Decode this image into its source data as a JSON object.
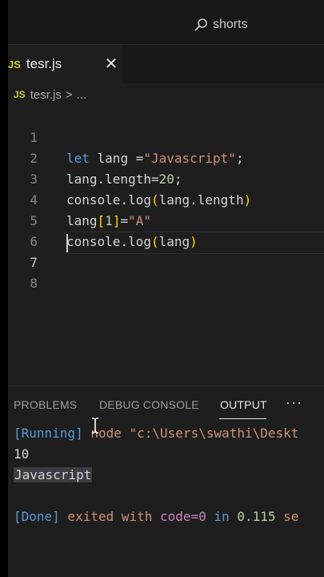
{
  "search": {
    "label": "shorts"
  },
  "tab": {
    "badge": "JS",
    "label": "tesr.js",
    "close": "✕"
  },
  "breadcrumb": {
    "badge": "JS",
    "file": "tesr.js",
    "sep": ">",
    "more": "..."
  },
  "editor": {
    "line_numbers": [
      "1",
      "2",
      "3",
      "4",
      "5",
      "6",
      "7",
      "8"
    ],
    "lines": {
      "l1": {
        "kw": "let",
        "rest": " lang =",
        "str": "\"Javascript\"",
        "end": ";"
      },
      "l2": {
        "a": "lang.length=",
        "num": "20",
        "end": ";"
      },
      "l3": {
        "a": "console.log",
        "po": "(",
        "mid": "lang.length",
        "pc": ")"
      },
      "l4": {
        "a": "lang",
        "bo": "[",
        "num": "1",
        "bc": "]",
        "eq": "=",
        "str": "\"A\""
      },
      "l5": {
        "a": "console.log",
        "po": "(",
        "mid": "lang",
        "pc": ")"
      }
    }
  },
  "panel": {
    "tabs": [
      "PROBLEMS",
      "DEBUG CONSOLE",
      "OUTPUT"
    ],
    "more": "···",
    "output": {
      "running": "[Running]",
      "command": " node \"c:\\Users\\swathi\\Deskt",
      "line2": "10",
      "line3": "Javascript",
      "done": "[Done]",
      "exited": " exited with ",
      "code": "code=0",
      "in": " in ",
      "time": "0.115",
      "sec": " se"
    }
  },
  "colors": {
    "keyword": "#569cd6",
    "string": "#ce9178",
    "number": "#b5cea8",
    "paren": "#ffd700",
    "bracket": "#da70d6",
    "js_badge": "#cbcb41"
  }
}
